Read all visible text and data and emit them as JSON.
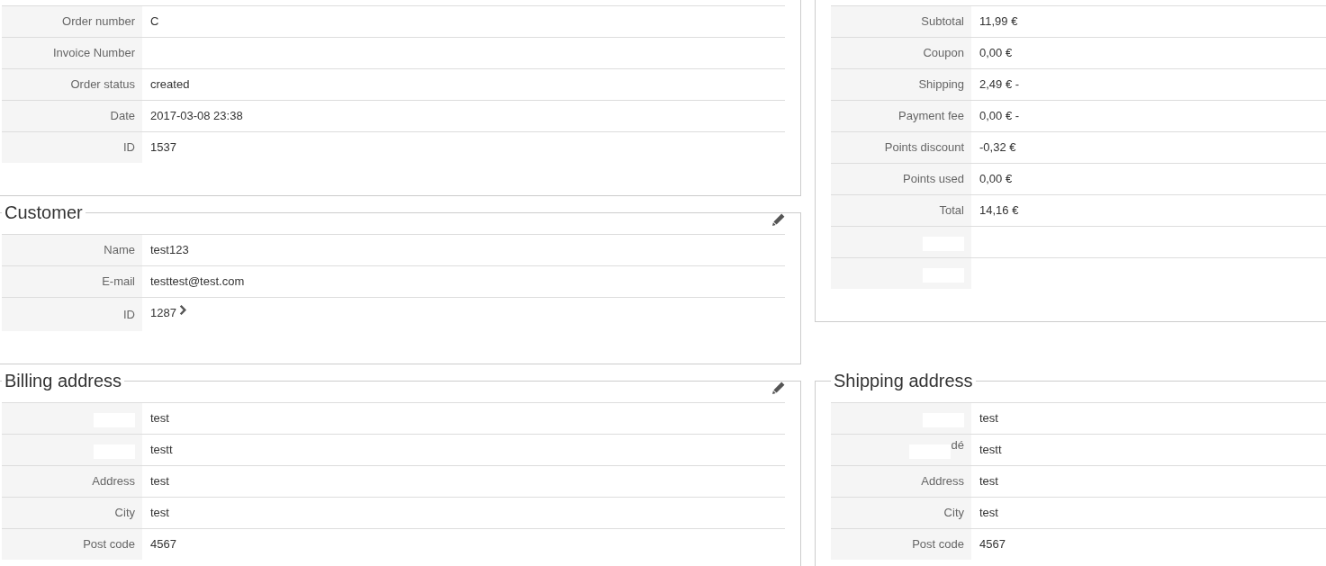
{
  "order_panel": {
    "rows": [
      {
        "label": "Order number",
        "value": "C"
      },
      {
        "label": "Invoice Number"
      },
      {
        "label": "Order status",
        "value": "created"
      },
      {
        "label": "Date",
        "value": "2017-03-08 23:38"
      },
      {
        "label": "ID",
        "value": "1537"
      }
    ]
  },
  "customer": {
    "title": "Customer",
    "editable": true,
    "rows": [
      {
        "label": "Name",
        "value": "test123"
      },
      {
        "label": "E-mail",
        "value": "testtest@test.com"
      },
      {
        "label": "ID",
        "value": "1287",
        "link": true
      }
    ]
  },
  "totals_panel": {
    "rows": [
      {
        "label": "Subtotal",
        "value": "11,99 €"
      },
      {
        "label": "Coupon",
        "value": "0,00 €"
      },
      {
        "label": "Shipping",
        "value": "2,49 € -"
      },
      {
        "label": "Payment fee",
        "value": "0,00 € -"
      },
      {
        "label": "Points discount",
        "value": "-0,32 €"
      },
      {
        "label": "Points used",
        "value": "0,00 €"
      },
      {
        "label": "Total",
        "value": "14,16 €"
      },
      {
        "redacted": true
      },
      {
        "redacted": true
      }
    ]
  },
  "billing_address": {
    "title": "Billing address",
    "editable": true,
    "rows": [
      {
        "redacted": true,
        "value": "test"
      },
      {
        "redacted": true,
        "value": "testt"
      },
      {
        "label": "Address",
        "value": "test"
      },
      {
        "label": "City",
        "value": "test"
      },
      {
        "label": "Post code",
        "value": "4567"
      }
    ]
  },
  "shipping_address": {
    "title": "Shipping address",
    "rows": [
      {
        "redacted": true,
        "value": "test"
      },
      {
        "label": "dé",
        "redacted": true,
        "value": "testt"
      },
      {
        "label": "Address",
        "value": "test"
      },
      {
        "label": "City",
        "value": "test"
      },
      {
        "label": "Post code",
        "value": "4567"
      }
    ]
  }
}
